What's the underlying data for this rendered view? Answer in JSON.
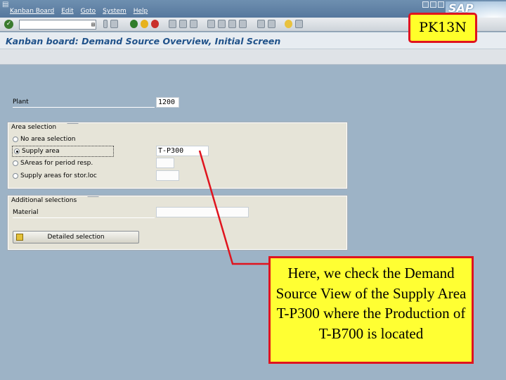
{
  "menubar": {
    "items": [
      "Kanban Board",
      "Edit",
      "Goto",
      "System",
      "Help"
    ]
  },
  "toolbar": {
    "command_field_value": "",
    "icons": [
      "enter-icon",
      "back-icon",
      "exit-icon",
      "cancel-icon",
      "print-icon",
      "find-icon",
      "find-next-icon",
      "first-page-icon",
      "prev-page-icon",
      "next-page-icon",
      "last-page-icon",
      "new-session-icon",
      "shortcut-icon",
      "help-icon",
      "layout-icon"
    ]
  },
  "screen": {
    "title": "Kanban board: Demand Source Overview, Initial Screen"
  },
  "form": {
    "plant_label": "Plant",
    "plant_value": "1200",
    "area_group_title": "Area selection",
    "radio_no_area": "No area selection",
    "radio_supply_area": "Supply area",
    "supply_area_value": "T-P300",
    "radio_areas_period": "SAreas for period resp.",
    "radio_areas_storloc": "Supply areas for stor.loc",
    "selected_radio": "supply_area",
    "additional_group_title": "Additional selections",
    "material_label": "Material",
    "material_value": "",
    "detail_button_label": "Detailed selection"
  },
  "annotation": {
    "tcode": "PK13N",
    "callout_text": "Here, we check the Demand Source View of the Supply Area T-P300 where the Production of T-B700 is located",
    "highlight_color": "#ffff33",
    "border_color": "#e0141e"
  },
  "brand": {
    "logo_text": "SAP"
  }
}
